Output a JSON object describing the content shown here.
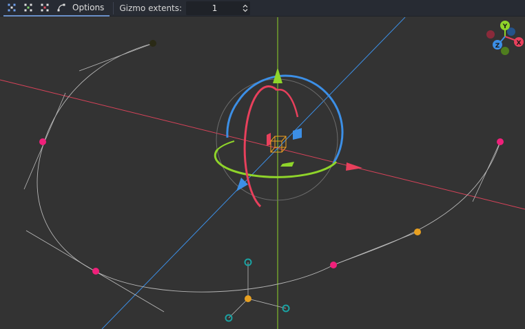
{
  "toolbar": {
    "buttons": [
      {
        "name": "curve-edit-icon"
      },
      {
        "name": "curve-create-icon"
      },
      {
        "name": "curve-delete-icon"
      },
      {
        "name": "curve-close-icon"
      }
    ],
    "options_label": "Options",
    "gizmo_label": "Gizmo extents:",
    "gizmo_value": "1"
  },
  "orientation_gizmo": {
    "y_label": "Y",
    "z_label": "Z",
    "x_label": "X"
  },
  "colors": {
    "background": "#333333",
    "toolbar": "#272b33",
    "x_axis": "#e8405c",
    "y_axis": "#8fd42a",
    "z_axis": "#3c8fe6",
    "curve_point": "#f0207a",
    "handle_in": "#e8a020",
    "handle_out": "#1a9c9c"
  }
}
